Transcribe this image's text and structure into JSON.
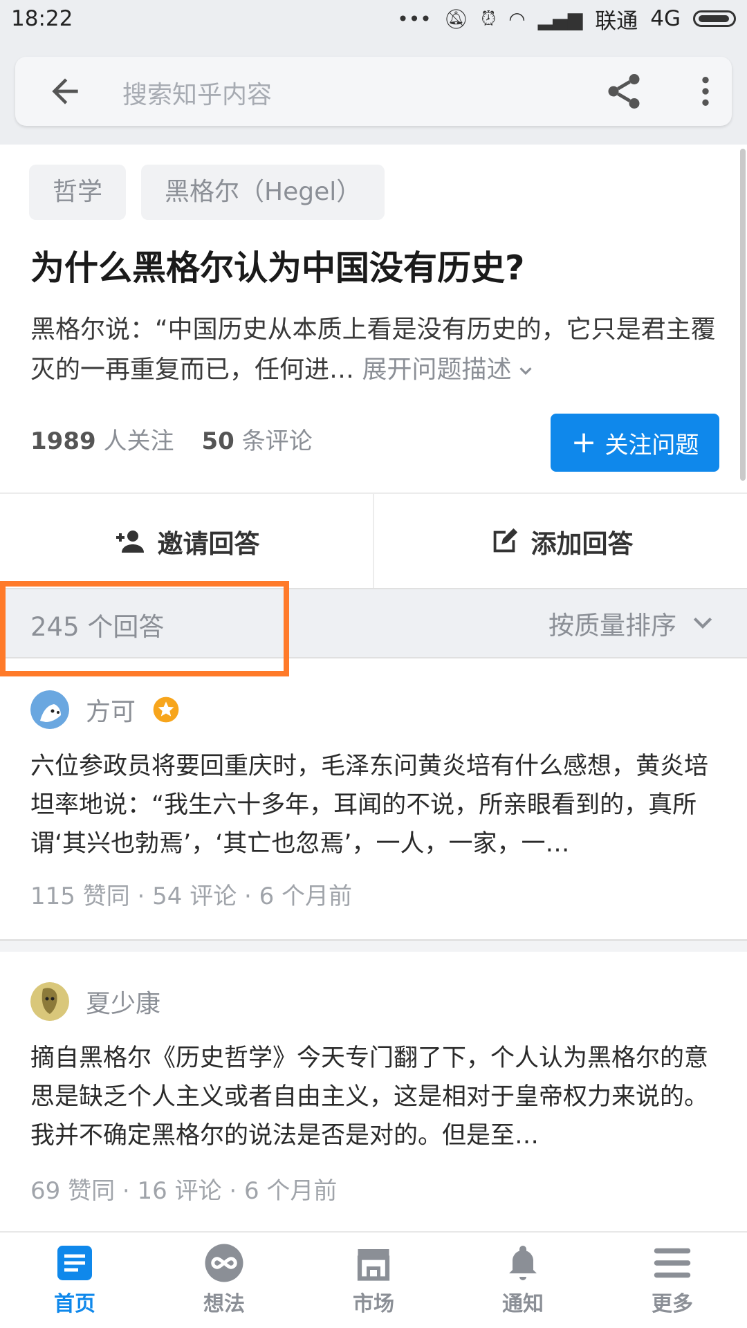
{
  "status_bar": {
    "time": "18:22",
    "carrier": "联通",
    "network": "4G"
  },
  "search": {
    "placeholder": "搜索知乎内容"
  },
  "question": {
    "tags": [
      "哲学",
      "黑格尔（Hegel）"
    ],
    "title": "为什么黑格尔认为中国没有历史?",
    "description": "黑格尔说：“中国历史从本质上看是没有历史的，它只是君主覆灭的一再重复而已，任何进… ",
    "expand_label": "展开问题描述",
    "followers_count": "1989",
    "followers_label": "人关注",
    "comments_count": "50",
    "comments_label": "条评论",
    "follow_button": "关注问题"
  },
  "actions": {
    "invite": "邀请回答",
    "add": "添加回答"
  },
  "answers_bar": {
    "count_label": "245 个回答",
    "sort_label": "按质量排序"
  },
  "answers": [
    {
      "author": "方可",
      "text": "六位参政员将要回重庆时，毛泽东问黄炎培有什么感想，黄炎培坦率地说：“我生六十多年，耳闻的不说，所亲眼看到的，真所谓‘其兴也勃焉’，‘其亡也忽焉’，一人，一家，一…",
      "meta": "115 赞同 · 54 评论 · 6 个月前"
    },
    {
      "author": "夏少康",
      "text": "摘自黑格尔《历史哲学》今天专门翻了下，个人认为黑格尔的意思是缺乏个人主义或者自由主义，这是相对于皇帝权力来说的。我并不确定黑格尔的说法是否是对的。但是至…",
      "meta": "69 赞同 · 16 评论 · 6 个月前"
    }
  ],
  "bottom_nav": [
    "首页",
    "想法",
    "市场",
    "通知",
    "更多"
  ],
  "colors": {
    "accent": "#0f88eb",
    "highlight": "#ff7a29"
  }
}
